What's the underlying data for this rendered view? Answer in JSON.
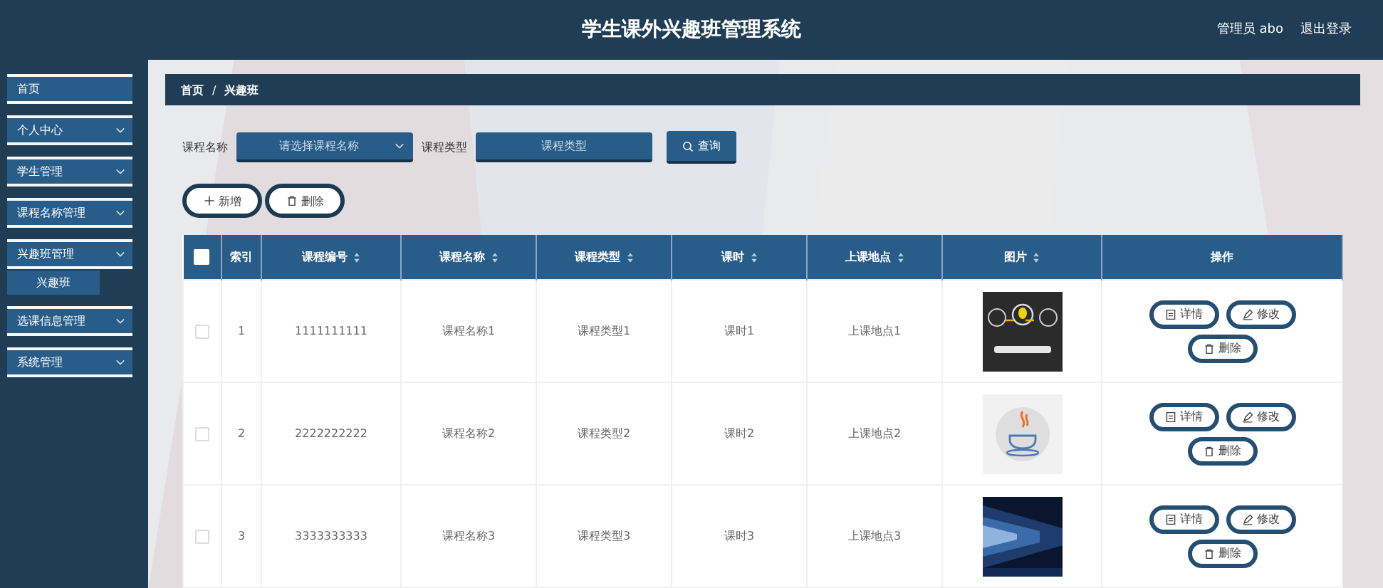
{
  "header": {
    "title": "学生课外兴趣班管理系统",
    "user": "管理员 abo",
    "logout": "退出登录"
  },
  "sidebar": {
    "items": [
      {
        "label": "首页",
        "kind": "link"
      },
      {
        "label": "个人中心",
        "kind": "submenu"
      },
      {
        "label": "学生管理",
        "kind": "submenu"
      },
      {
        "label": "课程名称管理",
        "kind": "submenu"
      },
      {
        "label": "兴趣班管理",
        "kind": "submenu",
        "children": [
          {
            "label": "兴趣班",
            "selected": true
          }
        ]
      },
      {
        "label": "选课信息管理",
        "kind": "submenu"
      },
      {
        "label": "系统管理",
        "kind": "submenu"
      }
    ]
  },
  "breadcrumb": [
    "首页",
    "/",
    "兴趣班"
  ],
  "search": {
    "fields": [
      {
        "label": "课程名称",
        "kind": "select",
        "placeholder": "请选择课程名称"
      },
      {
        "label": "课程类型",
        "kind": "input",
        "placeholder": "课程类型"
      }
    ],
    "button": "查询"
  },
  "actions": [
    {
      "label": "新增",
      "kind": "add"
    },
    {
      "label": "删除",
      "kind": "delete"
    }
  ],
  "table": {
    "select_all": {
      "checked": false
    },
    "columns": [
      {
        "label": "索引",
        "sortable": false
      },
      {
        "label": "课程编号",
        "sortable": true
      },
      {
        "label": "课程名称",
        "sortable": true
      },
      {
        "label": "课程类型",
        "sortable": true
      },
      {
        "label": "课时",
        "sortable": true
      },
      {
        "label": "上课地点",
        "sortable": true
      },
      {
        "label": "图片",
        "sortable": true
      },
      {
        "label": "操作",
        "sortable": false
      }
    ],
    "rows": [
      {
        "checked": false,
        "cells": [
          "1",
          "1111111111",
          "课程名称1",
          "课程类型1",
          "课时1",
          "上课地点1"
        ],
        "image": {
          "kind": "picture"
        },
        "actions": [
          {
            "label": "详情",
            "kind": "detail"
          },
          {
            "label": "修改",
            "kind": "edit"
          },
          {
            "label": "删除",
            "kind": "delete"
          }
        ]
      },
      {
        "checked": false,
        "cells": [
          "2",
          "2222222222",
          "课程名称2",
          "课程类型2",
          "课时2",
          "上课地点2"
        ],
        "image": {
          "kind": "picture"
        },
        "actions": [
          {
            "label": "详情",
            "kind": "detail"
          },
          {
            "label": "修改",
            "kind": "edit"
          },
          {
            "label": "删除",
            "kind": "delete"
          }
        ]
      },
      {
        "checked": false,
        "cells": [
          "3",
          "3333333333",
          "课程名称3",
          "课程类型3",
          "课时3",
          "上课地点3"
        ],
        "image": {
          "kind": "picture"
        },
        "actions": [
          {
            "label": "详情",
            "kind": "detail"
          },
          {
            "label": "修改",
            "kind": "edit"
          },
          {
            "label": "删除",
            "kind": "delete"
          }
        ]
      }
    ]
  }
}
